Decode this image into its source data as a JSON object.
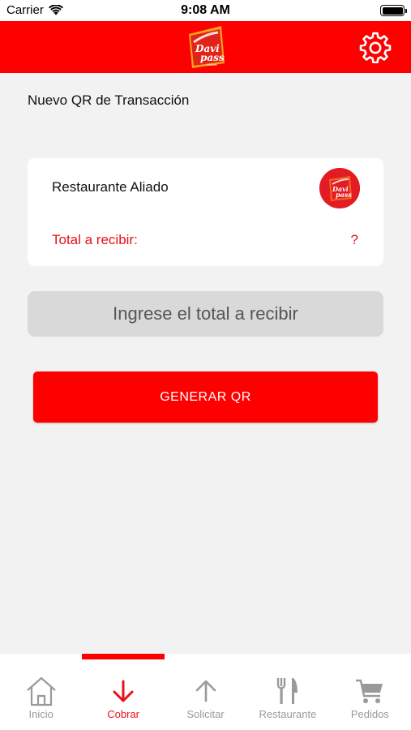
{
  "status_bar": {
    "carrier": "Carrier",
    "time": "9:08 AM"
  },
  "header": {
    "logo_text": [
      "Davi",
      "pass"
    ],
    "logo_subtext": "Aliados"
  },
  "main": {
    "title": "Nuevo QR de Transacción",
    "card": {
      "merchant_name": "Restaurante Aliado",
      "total_label": "Total a recibir:",
      "total_value": "?"
    },
    "amount_input_placeholder": "Ingrese el total a recibir",
    "generate_button": "GENERAR QR"
  },
  "tabs": [
    {
      "label": "Inicio",
      "icon": "home-icon",
      "active": false
    },
    {
      "label": "Cobrar",
      "icon": "arrow-down-icon",
      "active": true
    },
    {
      "label": "Solicitar",
      "icon": "arrow-up-icon",
      "active": false
    },
    {
      "label": "Restaurante",
      "icon": "fork-knife-icon",
      "active": false
    },
    {
      "label": "Pedidos",
      "icon": "cart-icon",
      "active": false
    }
  ],
  "colors": {
    "brand_red": "#ff0000",
    "text_red": "#e8101a",
    "inactive_gray": "#9a9a9a"
  }
}
